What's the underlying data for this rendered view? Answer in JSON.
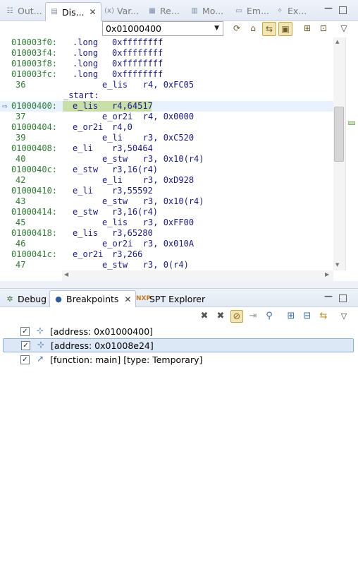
{
  "top_tabs": [
    {
      "label": "Out...",
      "icon": "outline-icon"
    },
    {
      "label": "Dis...",
      "icon": "disassembly-icon",
      "active": true
    },
    {
      "label": "Var...",
      "icon": "variables-icon"
    },
    {
      "label": "Re...",
      "icon": "registers-icon"
    },
    {
      "label": "Mo...",
      "icon": "memory-icon"
    },
    {
      "label": "Em...",
      "icon": "emulator-icon"
    },
    {
      "label": "Ex...",
      "icon": "expressions-icon"
    }
  ],
  "address_input": {
    "value": "0x01000400"
  },
  "disassembly_rows": [
    {
      "addr": "010003f0:",
      "instr": ".long",
      "ops": "0xffffffff"
    },
    {
      "addr": "010003f4:",
      "instr": ".long",
      "ops": "0xffffffff"
    },
    {
      "addr": "010003f8:",
      "instr": ".long",
      "ops": "0xffffffff"
    },
    {
      "addr": "010003fc:",
      "instr": ".long",
      "ops": "0xffffffff"
    },
    {
      "line": "36",
      "src": "e_lis   r4, 0xFC05"
    },
    {
      "label": "_start:"
    },
    {
      "addr": "01000400:",
      "instr": "e_lis",
      "ops": "r4,64517",
      "current": true
    },
    {
      "line": "37",
      "src": "e_or2i  r4, 0x0000"
    },
    {
      "addr": "01000404:",
      "instr": "e_or2i",
      "ops": "r4,0"
    },
    {
      "line": "39",
      "src": "e_li    r3, 0xC520"
    },
    {
      "addr": "01000408:",
      "instr": "e_li",
      "ops": "r3,50464"
    },
    {
      "line": "40",
      "src": "e_stw   r3, 0x10(r4)"
    },
    {
      "addr": "0100040c:",
      "instr": "e_stw",
      "ops": "r3,16(r4)"
    },
    {
      "line": "42",
      "src": "e_li    r3, 0xD928"
    },
    {
      "addr": "01000410:",
      "instr": "e_li",
      "ops": "r3,55592"
    },
    {
      "line": "43",
      "src": "e_stw   r3, 0x10(r4)"
    },
    {
      "addr": "01000414:",
      "instr": "e_stw",
      "ops": "r3,16(r4)"
    },
    {
      "line": "45",
      "src": "e_lis   r3, 0xFF00"
    },
    {
      "addr": "01000418:",
      "instr": "e_lis",
      "ops": "r3,65280"
    },
    {
      "line": "46",
      "src": "e_or2i  r3, 0x010A"
    },
    {
      "addr": "0100041c:",
      "instr": "e_or2i",
      "ops": "r3,266"
    },
    {
      "line": "47",
      "src": "e_stw   r3, 0(r4)"
    }
  ],
  "bottom_tabs": [
    {
      "label": "Debug",
      "icon": "debug-icon"
    },
    {
      "label": "Breakpoints",
      "icon": "breakpoints-icon",
      "active": true
    },
    {
      "label": "SPT Explorer",
      "icon": "spt-explorer-icon"
    }
  ],
  "breakpoints": [
    {
      "text": "[address: 0x01000400]",
      "checked": true,
      "icon": "address-breakpoint-icon"
    },
    {
      "text": "[address: 0x01008e24]",
      "checked": true,
      "icon": "address-breakpoint-icon",
      "selected": true
    },
    {
      "text": "[function: main] [type: Temporary]",
      "checked": true,
      "icon": "function-breakpoint-icon"
    }
  ],
  "colors": {
    "address_green": "#2e7d32",
    "asm_blue": "#1a1a8c",
    "current_line_bg": "#c8dfa8",
    "selection_bg": "#dde8f6"
  }
}
